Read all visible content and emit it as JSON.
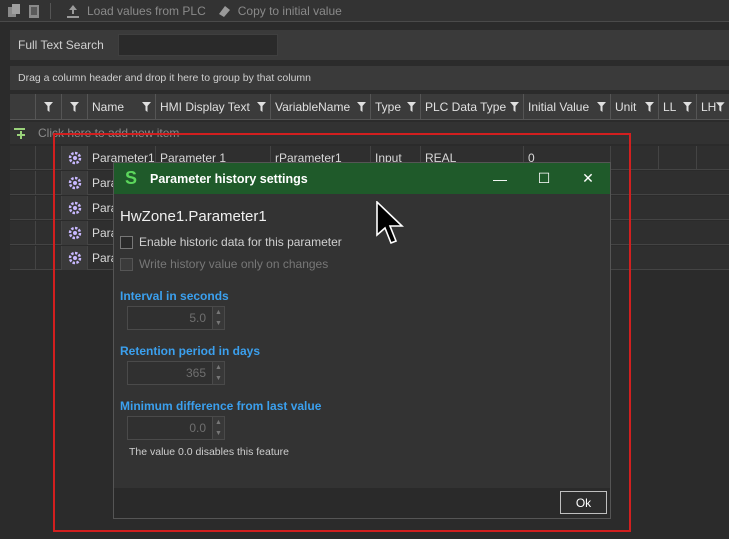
{
  "toolbar": {
    "load_label": "Load values from PLC",
    "copy_label": "Copy to initial value"
  },
  "search": {
    "label": "Full Text Search",
    "value": ""
  },
  "grouping_hint": "Drag a column header and drop it here to group by that column",
  "grid": {
    "columns": [
      "Name",
      "HMI Display Text",
      "VariableName",
      "Type",
      "PLC Data Type",
      "Initial Value",
      "Unit",
      "LL",
      "LH"
    ],
    "new_row_hint": "Click here to add new item",
    "rows": [
      {
        "name": "Parameter1",
        "display": "Parameter 1",
        "variable": "rParameter1",
        "type": "Input",
        "plc_type": "REAL",
        "initial": "0"
      },
      {
        "name": "Para",
        "display": "",
        "variable": "",
        "type": "",
        "plc_type": "",
        "initial": ""
      },
      {
        "name": "Para",
        "display": "",
        "variable": "",
        "type": "",
        "plc_type": "",
        "initial": ""
      },
      {
        "name": "Para",
        "display": "",
        "variable": "",
        "type": "",
        "plc_type": "",
        "initial": ""
      },
      {
        "name": "Para",
        "display": "",
        "variable": "",
        "type": "",
        "plc_type": "",
        "initial": ""
      }
    ]
  },
  "dialog": {
    "logo_letter": "S",
    "title": "Parameter history settings",
    "param_title": "HwZone1.Parameter1",
    "enable_label": "Enable historic data for this parameter",
    "write_label": "Write history value only on changes",
    "interval_label": "Interval in seconds",
    "interval_value": "5.0",
    "retention_label": "Retention period in days",
    "retention_value": "365",
    "mindiff_label": "Minimum difference from last value",
    "mindiff_value": "0.0",
    "note": "The value 0.0 disables this feature",
    "ok_label": "Ok",
    "minimize_glyph": "—",
    "maximize_glyph": "☐",
    "close_glyph": "✕"
  },
  "colors": {
    "title_bar": "#1f5a2a",
    "accent_blue": "#3ba0ee",
    "frame_red": "#d21f1f"
  }
}
